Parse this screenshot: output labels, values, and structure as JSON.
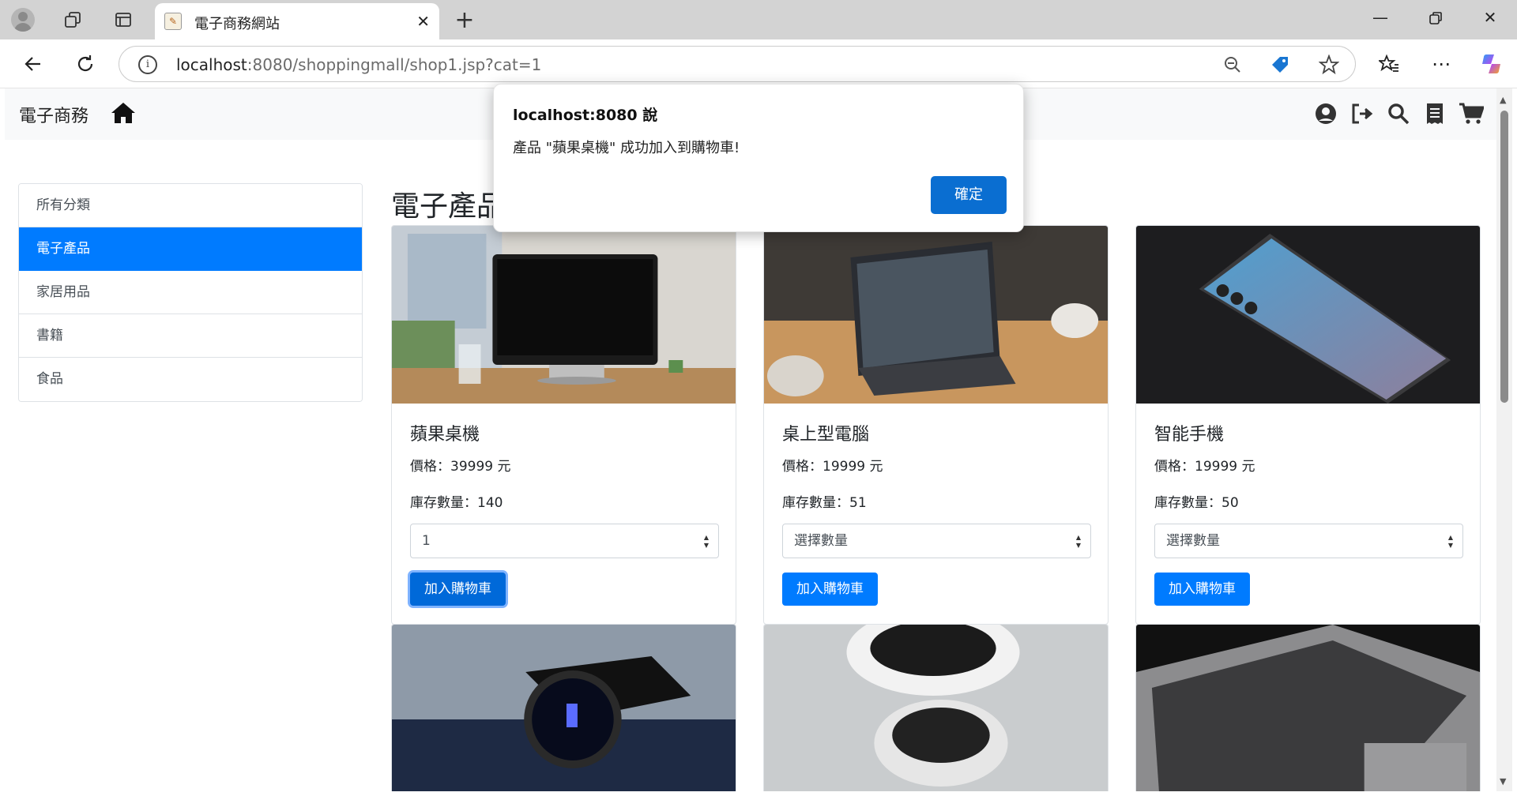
{
  "browser": {
    "tab_title": "電子商務網站",
    "url_host": "localhost",
    "url_rest": ":8080/shoppingmall/shop1.jsp?cat=1"
  },
  "site": {
    "brand": "電子商務",
    "accent": "#007bff"
  },
  "sidebar": {
    "items": [
      {
        "label": "所有分類"
      },
      {
        "label": "電子產品"
      },
      {
        "label": "家居用品"
      },
      {
        "label": "書籍"
      },
      {
        "label": "食品"
      }
    ],
    "active_index": 1
  },
  "main": {
    "heading": "電子產品"
  },
  "products": [
    {
      "name": "蘋果桌機",
      "price": "價格：39999 元",
      "stock": "庫存數量：140",
      "qty": "1",
      "button": "加入購物車"
    },
    {
      "name": "桌上型電腦",
      "price": "價格：19999 元",
      "stock": "庫存數量：51",
      "qty": "選擇數量",
      "button": "加入購物車"
    },
    {
      "name": "智能手機",
      "price": "價格：19999 元",
      "stock": "庫存數量：50",
      "qty": "選擇數量",
      "button": "加入購物車"
    }
  ],
  "dialog": {
    "title": "localhost:8080 說",
    "message": "產品 \"蘋果桌機\" 成功加入到購物車!",
    "ok": "確定"
  }
}
